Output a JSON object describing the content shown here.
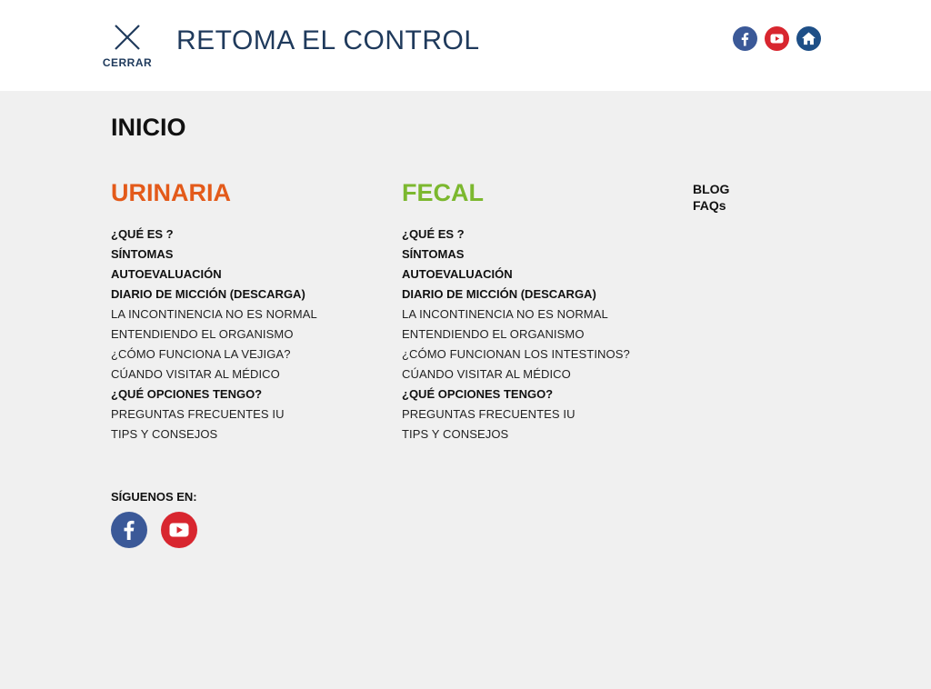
{
  "header": {
    "close_label": "CERRAR",
    "title": "RETOMA EL CONTROL",
    "social": [
      {
        "icon": "facebook-icon",
        "color": "#3b5998"
      },
      {
        "icon": "youtube-icon",
        "color": "#d8262f"
      },
      {
        "icon": "home-icon",
        "color": "#1e4f87"
      }
    ]
  },
  "nav": {
    "inicio": "INICIO",
    "urinaria": {
      "title": "URINARIA",
      "color": "#e35a1a",
      "items": [
        "¿QUÉ ES ?",
        "SÍNTOMAS",
        "AUTOEVALUACIÓN",
        "DIARIO DE MICCIÓN (DESCARGA)",
        "LA INCONTINENCIA NO ES NORMAL",
        "ENTENDIENDO EL ORGANISMO",
        "¿CÓMO FUNCIONA LA VEJIGA?",
        "CÚANDO VISITAR  AL MÉDICO",
        "¿QUÉ OPCIONES TENGO?",
        "PREGUNTAS FRECUENTES IU",
        "TIPS Y CONSEJOS"
      ]
    },
    "fecal": {
      "title": "FECAL",
      "color": "#7cb82f",
      "items": [
        "¿QUÉ ES ?",
        "SÍNTOMAS",
        "AUTOEVALUACIÓN",
        "DIARIO DE MICCIÓN (DESCARGA)",
        "LA INCONTINENCIA NO ES NORMAL",
        "ENTENDIENDO EL ORGANISMO",
        "¿CÓMO FUNCIONAN LOS INTESTINOS?",
        "CÚANDO VISITAR  AL MÉDICO",
        "¿QUÉ OPCIONES TENGO?",
        "PREGUNTAS FRECUENTES IU",
        "TIPS Y CONSEJOS"
      ]
    },
    "extra": {
      "blog": "BLOG",
      "faqs": "FAQs"
    }
  },
  "follow": {
    "label": "SÍGUENOS EN:",
    "facebook_color": "#3b5998",
    "youtube_color": "#d8262f"
  }
}
